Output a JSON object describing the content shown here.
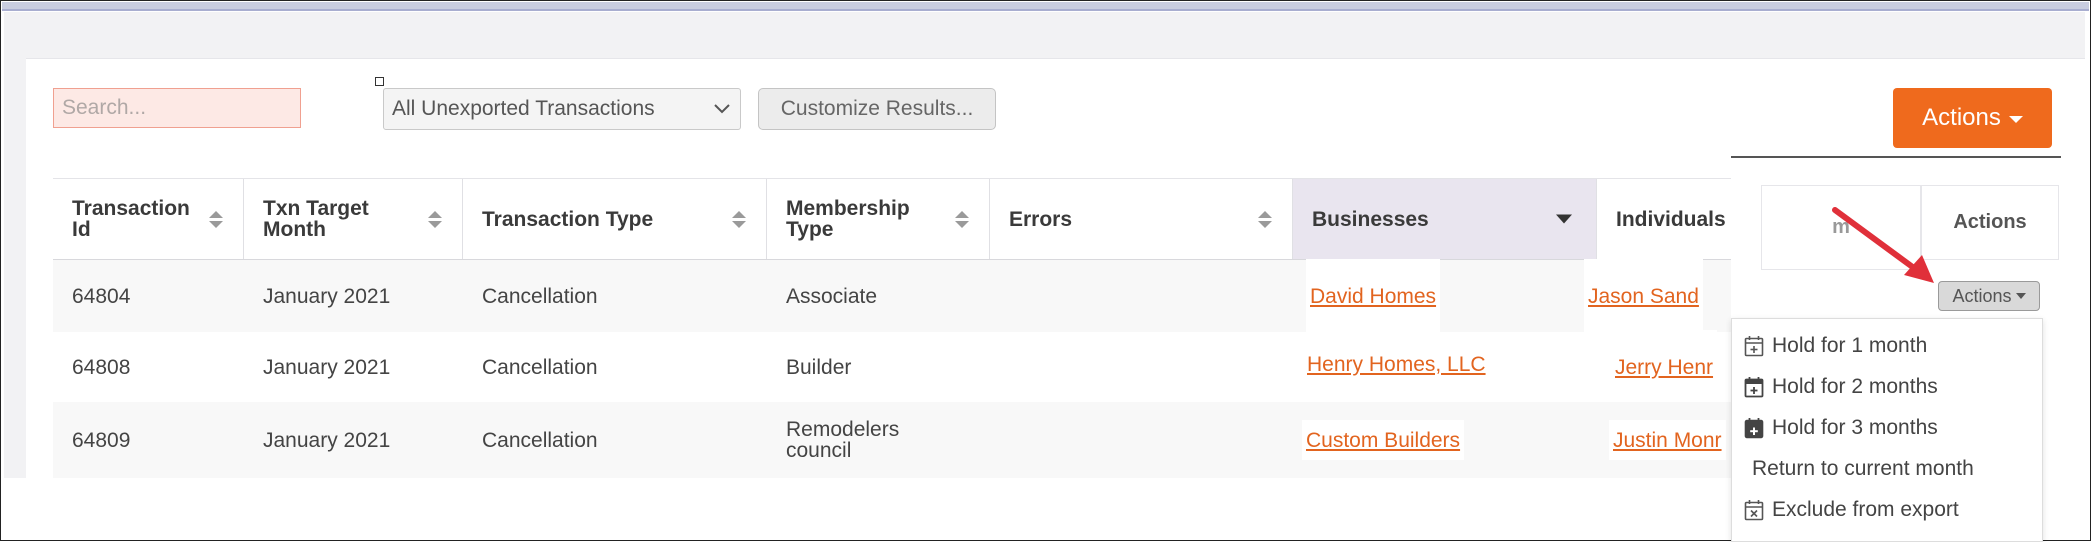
{
  "toolbar": {
    "search_placeholder": "Search...",
    "filter_selected": "All Unexported Transactions",
    "customize_label": "Customize Results...",
    "actions_label": "Actions"
  },
  "table": {
    "columns": [
      {
        "label": "Transaction\nId",
        "sortable": true
      },
      {
        "label": "Txn Target\nMonth",
        "sortable": true
      },
      {
        "label": "Transaction Type",
        "sortable": true
      },
      {
        "label": "Membership\nType",
        "sortable": true
      },
      {
        "label": "Errors",
        "sortable": true
      },
      {
        "label": "Businesses",
        "sort": "desc",
        "active": true
      },
      {
        "label": "Individuals",
        "sortable": false
      }
    ],
    "rows": [
      {
        "id": "64804",
        "month": "January 2021",
        "type": "Cancellation",
        "membership": "Associate",
        "errors": "",
        "business": "David Homes",
        "individual": "Jason Sand"
      },
      {
        "id": "64808",
        "month": "January 2021",
        "type": "Cancellation",
        "membership": "Builder",
        "errors": "",
        "business": "Henry Homes, LLC",
        "individual": "Jerry  Henr"
      },
      {
        "id": "64809",
        "month": "January 2021",
        "type": "Cancellation",
        "membership": "Remodelers\ncouncil",
        "errors": "",
        "business": "Custom Builders",
        "individual": "Justin Monr"
      }
    ]
  },
  "right_column": {
    "header_partial": "m",
    "header_actions": "Actions",
    "row_actions_label": "Actions"
  },
  "dropdown": {
    "items": [
      {
        "label": "Hold for 1 month",
        "icon": "calendar-plus-icon"
      },
      {
        "label": "Hold for 2 months",
        "icon": "calendar-plus-icon"
      },
      {
        "label": "Hold for 3 months",
        "icon": "calendar-plus-filled-icon"
      },
      {
        "label": "Return to current month",
        "icon": ""
      },
      {
        "label": "Exclude from export",
        "icon": "calendar-x-icon"
      }
    ]
  },
  "colors": {
    "accent": "#ef6a1d",
    "link": "#e2641f",
    "arrow": "#e0303a"
  }
}
